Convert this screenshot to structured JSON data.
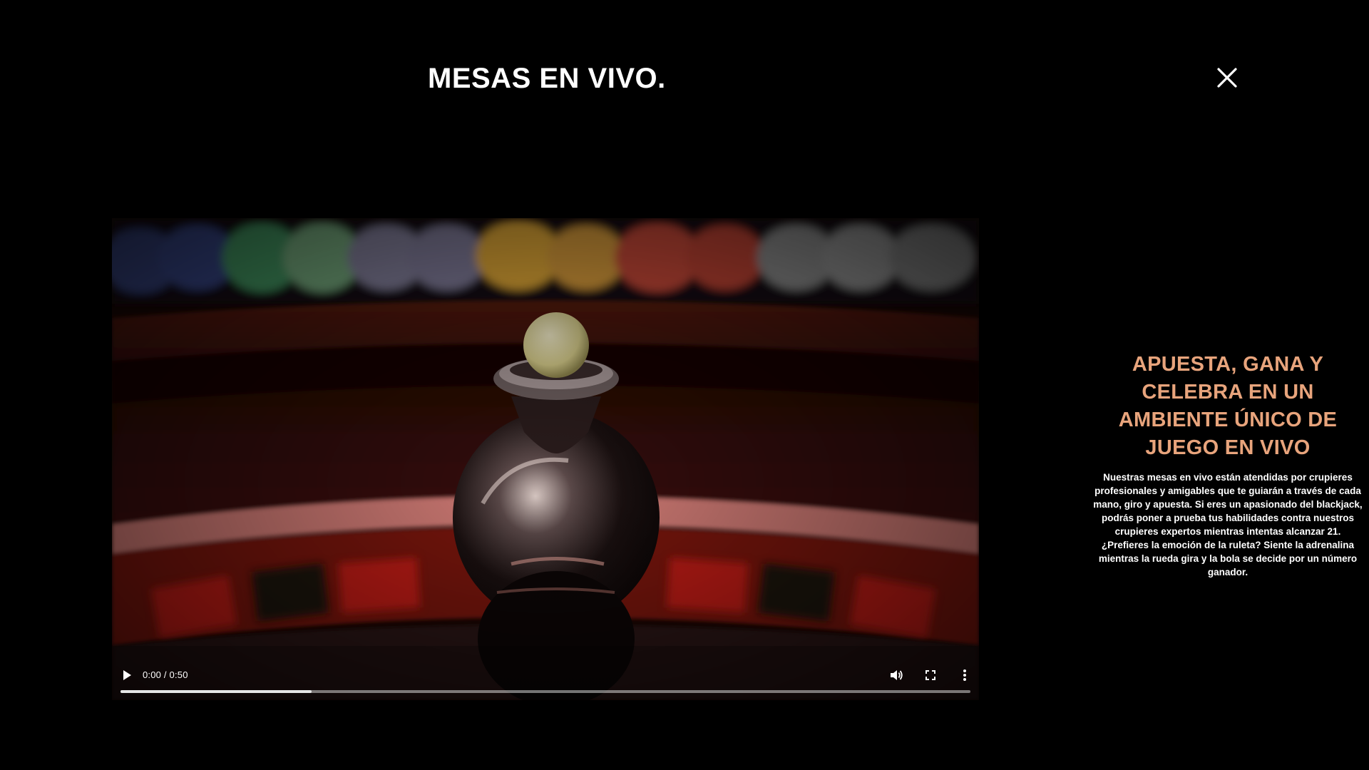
{
  "modal": {
    "title": "MESAS EN VIVO.",
    "close_icon": "close-icon"
  },
  "video": {
    "time_display": "0:00 / 0:50",
    "progress_fraction": 0.225,
    "icons": {
      "play": "play-icon",
      "volume": "volume-icon",
      "fullscreen": "fullscreen-icon",
      "more": "more-vertical-icon"
    }
  },
  "side": {
    "heading": "APUESTA, GANA Y CELEBRA EN UN AMBIENTE ÚNICO DE JUEGO EN VIVO",
    "body": "Nuestras mesas en vivo están atendidas por crupieres profesionales y amigables que te guiarán a través de cada mano, giro y apuesta. Si eres un apasionado del blackjack, podrás poner a prueba tus habilidades contra nuestros crupieres expertos mientras intentas alcanzar 21. ¿Prefieres la emoción de la ruleta? Siente la adrenalina mientras la rueda gira y la bola se decide por un número ganador."
  },
  "colors": {
    "background": "#000000",
    "heading_accent": "#e8a47c",
    "text": "#ffffff"
  }
}
